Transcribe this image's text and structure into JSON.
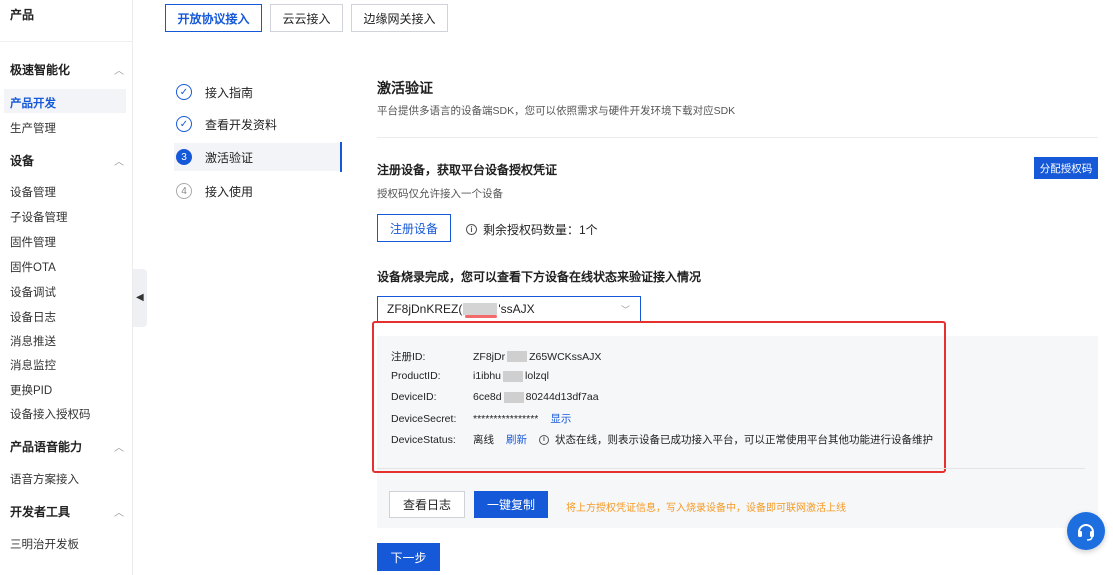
{
  "sidebar": {
    "header": "产品",
    "groups": [
      {
        "label": "极速智能化",
        "items": [
          "产品开发",
          "生产管理"
        ]
      },
      {
        "label": "设备",
        "items": [
          "设备管理",
          "子设备管理",
          "固件管理",
          "固件OTA",
          "设备调试",
          "设备日志",
          "消息推送",
          "消息监控",
          "更换PID",
          "设备接入授权码"
        ]
      },
      {
        "label": "产品语音能力",
        "items": [
          "语音方案接入"
        ]
      },
      {
        "label": "开发者工具",
        "items": [
          "三明治开发板"
        ]
      }
    ],
    "active_item": "产品开发"
  },
  "tabs": [
    "开放协议接入",
    "云云接入",
    "边缘网关接入"
  ],
  "steps": [
    {
      "num": "✓",
      "label": "接入指南",
      "state": "done"
    },
    {
      "num": "✓",
      "label": "查看开发资料",
      "state": "done"
    },
    {
      "num": "3",
      "label": "激活验证",
      "state": "current"
    },
    {
      "num": "4",
      "label": "接入使用",
      "state": "todo"
    }
  ],
  "main": {
    "title": "激活验证",
    "subtitle": "平台提供多语言的设备端SDK，您可以依照需求与硬件开发环境下载对应SDK",
    "register_section_title": "注册设备，获取平台设备授权凭证",
    "register_note": "授权码仅允许接入一个设备",
    "assign_button": "分配授权码",
    "register_button": "注册设备",
    "remaining_label": "剩余授权码数量：1个",
    "burn_section_title": "设备烧录完成，您可以查看下方设备在线状态来验证接入情况",
    "select_value_prefix": "ZF8jDnKREZ(",
    "select_value_suffix": "'ssAJX"
  },
  "details": {
    "reg_id_label": "注册ID:",
    "reg_id_prefix": "ZF8jDr",
    "reg_id_suffix": "Z65WCKssAJX",
    "product_id_label": "ProductID:",
    "product_id_prefix": "i1ibhu",
    "product_id_suffix": "lolzql",
    "device_id_label": "DeviceID:",
    "device_id_prefix": "6ce8d",
    "device_id_suffix": "80244d13df7aa",
    "device_secret_label": "DeviceSecret:",
    "device_secret_value": "****************",
    "show_link": "显示",
    "status_label": "DeviceStatus:",
    "status_value": "离线",
    "refresh_link": "刷新",
    "status_hint": "状态在线，则表示设备已成功接入平台，可以正常使用平台其他功能进行设备维护"
  },
  "actions": {
    "log_button": "查看日志",
    "copy_button": "一键复制",
    "copy_note": "将上方授权凭证信息，写入烧录设备中，设备即可联网激活上线",
    "next_button": "下一步"
  },
  "colors": {
    "primary": "#1659d8",
    "highlight": "#e53030",
    "warning": "#f59a23"
  }
}
